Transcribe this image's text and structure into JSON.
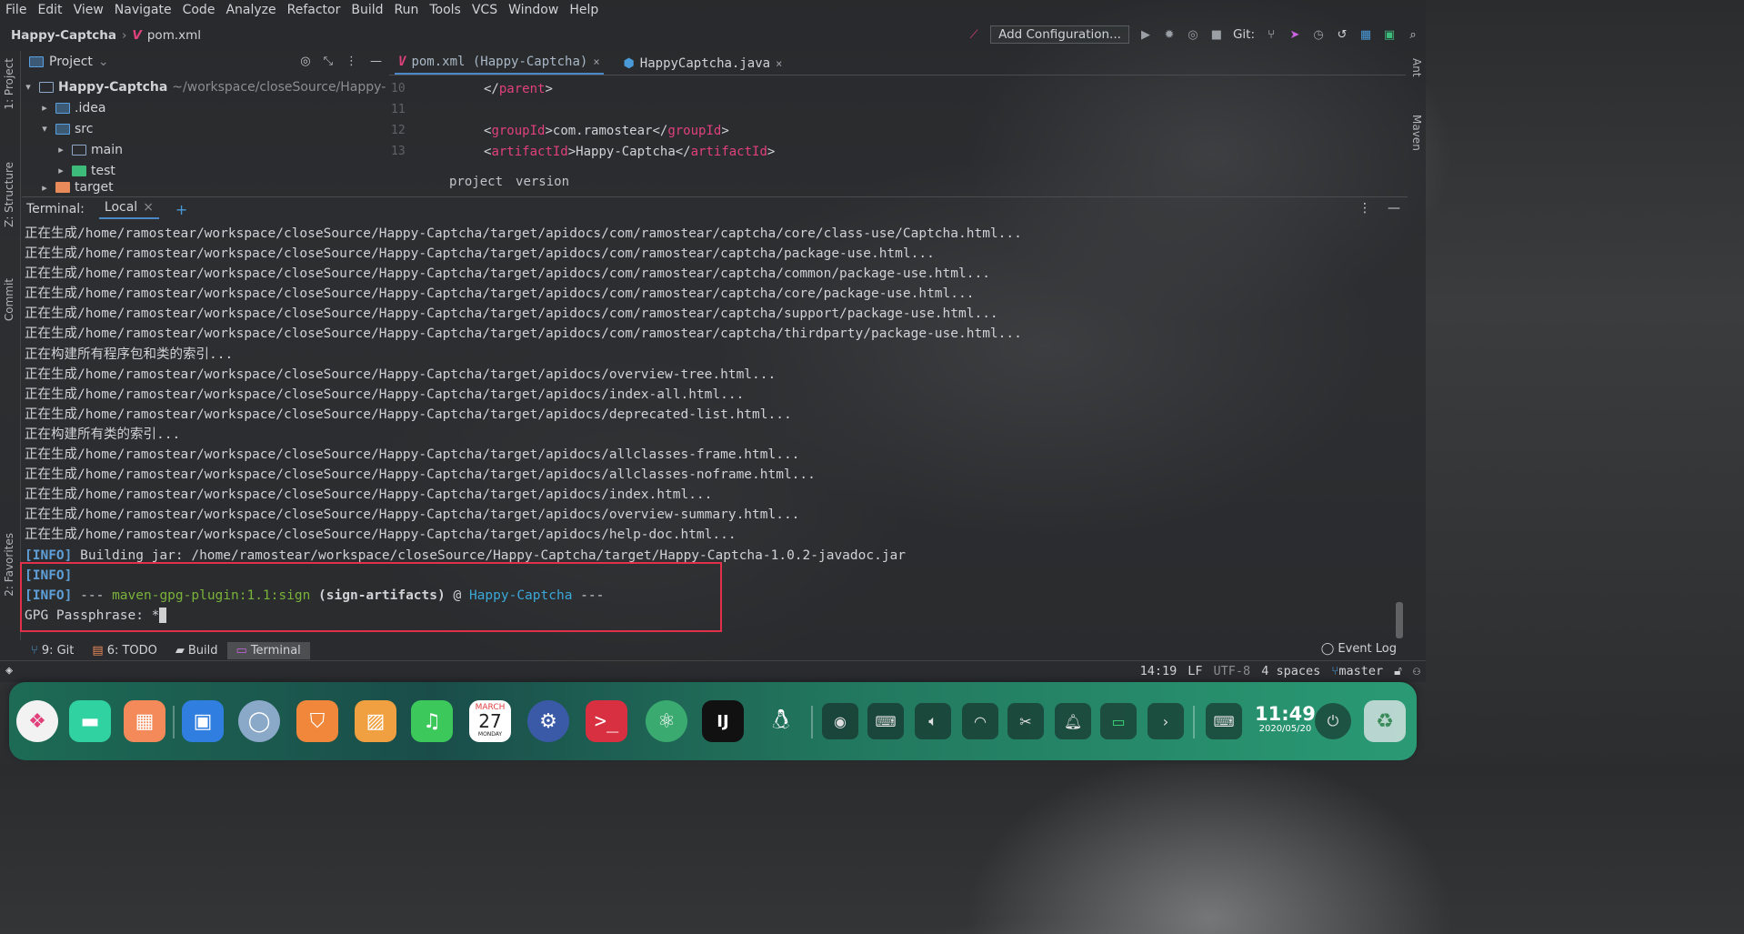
{
  "menu": [
    "File",
    "Edit",
    "View",
    "Navigate",
    "Code",
    "Analyze",
    "Refactor",
    "Build",
    "Run",
    "Tools",
    "VCS",
    "Window",
    "Help"
  ],
  "nav": {
    "project": "Happy-Captcha",
    "file": "pom.xml",
    "config": "Add Configuration...",
    "git_label": "Git:"
  },
  "left_tabs": {
    "project": "1: Project",
    "structure": "Z: Structure",
    "commit": "Commit",
    "favorites": "2: Favorites"
  },
  "right_tabs": {
    "ant": "Ant",
    "maven": "Maven"
  },
  "project_panel": {
    "title": "Project",
    "tree": [
      {
        "name": "Happy-Captcha",
        "path": "~/workspace/closeSource/Happy-"
      },
      {
        "name": ".idea"
      },
      {
        "name": "src"
      },
      {
        "name": "main"
      },
      {
        "name": "test"
      },
      {
        "name": "target"
      }
    ]
  },
  "editor": {
    "tabs": [
      {
        "label": "pom.xml (Happy-Captcha)"
      },
      {
        "label": "HappyCaptcha.java"
      }
    ],
    "lines": [
      {
        "num": "10",
        "open": "</",
        "name": "parent",
        "close": ">",
        "text": "",
        "end_open": "",
        "end_name": "",
        "end_close": ""
      },
      {
        "num": "11",
        "open": "",
        "name": "",
        "close": "",
        "text": "",
        "end_open": "",
        "end_name": "",
        "end_close": ""
      },
      {
        "num": "12",
        "open": "<",
        "name": "groupId",
        "close": ">",
        "text": "com.ramostear",
        "end_open": "</",
        "end_name": "groupId",
        "end_close": ">"
      },
      {
        "num": "13",
        "open": "<",
        "name": "artifactId",
        "close": ">",
        "text": "Happy-Captcha",
        "end_open": "</",
        "end_name": "artifactId",
        "end_close": ">"
      }
    ],
    "breadcrumbs": [
      "project",
      "version"
    ]
  },
  "terminal": {
    "label": "Terminal:",
    "tab": "Local",
    "lines": [
      "正在生成/home/ramostear/workspace/closeSource/Happy-Captcha/target/apidocs/com/ramostear/captcha/core/class-use/Captcha.html...",
      "正在生成/home/ramostear/workspace/closeSource/Happy-Captcha/target/apidocs/com/ramostear/captcha/package-use.html...",
      "正在生成/home/ramostear/workspace/closeSource/Happy-Captcha/target/apidocs/com/ramostear/captcha/common/package-use.html...",
      "正在生成/home/ramostear/workspace/closeSource/Happy-Captcha/target/apidocs/com/ramostear/captcha/core/package-use.html...",
      "正在生成/home/ramostear/workspace/closeSource/Happy-Captcha/target/apidocs/com/ramostear/captcha/support/package-use.html...",
      "正在生成/home/ramostear/workspace/closeSource/Happy-Captcha/target/apidocs/com/ramostear/captcha/thirdparty/package-use.html...",
      "正在构建所有程序包和类的索引...",
      "正在生成/home/ramostear/workspace/closeSource/Happy-Captcha/target/apidocs/overview-tree.html...",
      "正在生成/home/ramostear/workspace/closeSource/Happy-Captcha/target/apidocs/index-all.html...",
      "正在生成/home/ramostear/workspace/closeSource/Happy-Captcha/target/apidocs/deprecated-list.html...",
      "正在构建所有类的索引...",
      "正在生成/home/ramostear/workspace/closeSource/Happy-Captcha/target/apidocs/allclasses-frame.html...",
      "正在生成/home/ramostear/workspace/closeSource/Happy-Captcha/target/apidocs/allclasses-noframe.html...",
      "正在生成/home/ramostear/workspace/closeSource/Happy-Captcha/target/apidocs/index.html...",
      "正在生成/home/ramostear/workspace/closeSource/Happy-Captcha/target/apidocs/overview-summary.html...",
      "正在生成/home/ramostear/workspace/closeSource/Happy-Captcha/target/apidocs/help-doc.html...",
      "[INFO] Building jar: /home/ramostear/workspace/closeSource/Happy-Captcha/target/Happy-Captcha-1.0.2-javadoc.jar"
    ],
    "info_tag": "[INFO]",
    "gpg_line": {
      "tag": "[INFO]",
      "dashes": "---",
      "plugin": "maven-gpg-plugin:1.1:sign",
      "exec": "(sign-artifacts)",
      "at": "@",
      "project": "Happy-Captcha",
      "end": "---"
    },
    "prompt": "GPG Passphrase: *"
  },
  "bottom_tabs": [
    {
      "label": "9: Git"
    },
    {
      "label": "6: TODO"
    },
    {
      "label": "Build"
    },
    {
      "label": "Terminal"
    }
  ],
  "event_log": "Event Log",
  "status": {
    "position": "14:19",
    "line_sep": "LF",
    "encoding": "UTF-8",
    "indent": "4 spaces",
    "branch": "master"
  },
  "clock": {
    "time": "11:49",
    "date": "2020/05/20"
  },
  "calendar": {
    "month": "MARCH",
    "day": "27",
    "weekday": "MONDAY"
  },
  "colors": {
    "accent": "#4a88c7",
    "highlight_border": "#e0304a",
    "maven_logo": "#e0417a"
  }
}
